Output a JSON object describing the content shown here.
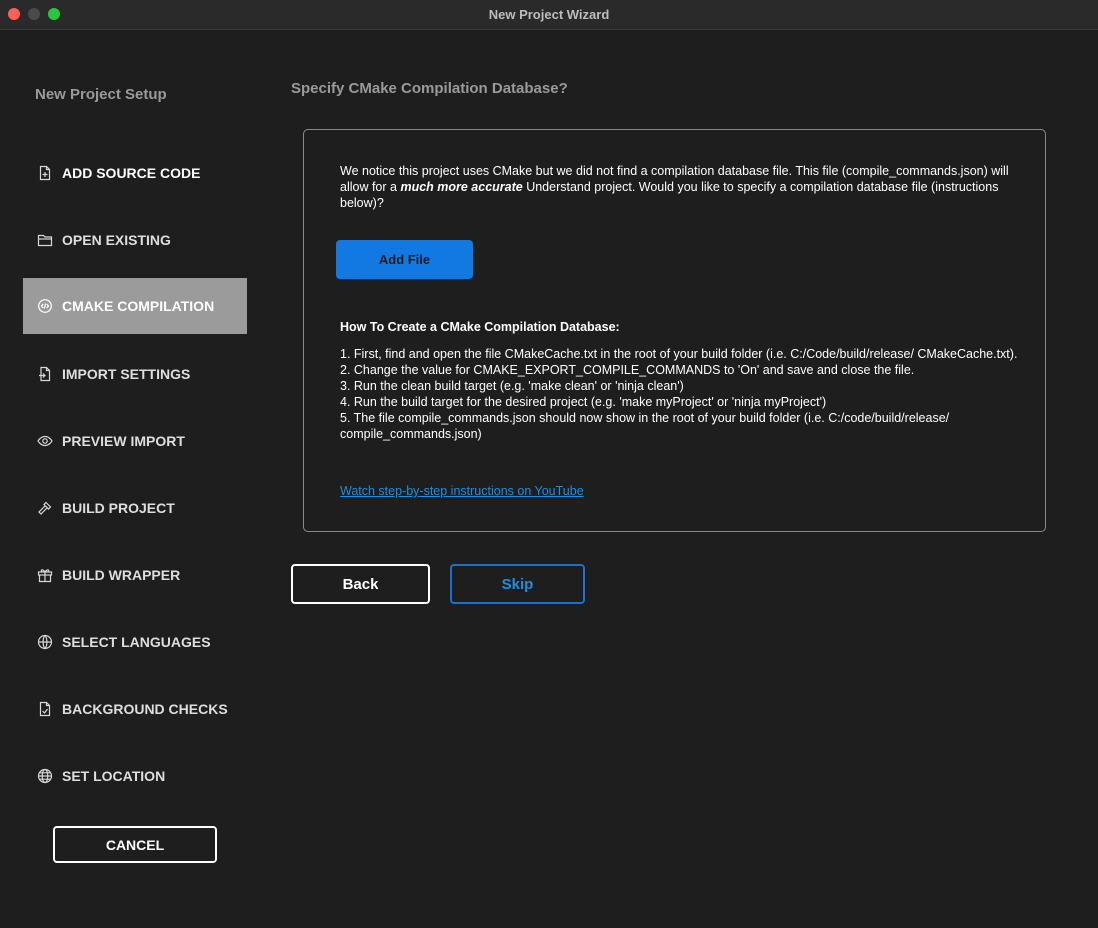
{
  "window": {
    "title": "New Project Wizard"
  },
  "sidebar": {
    "heading": "New Project Setup",
    "items": [
      {
        "label": "ADD SOURCE CODE",
        "icon": "file-add-icon"
      },
      {
        "label": "OPEN EXISTING",
        "icon": "folder-open-icon"
      },
      {
        "label": "CMAKE COMPILATION",
        "icon": "code-gear-icon",
        "active": true
      },
      {
        "label": "IMPORT SETTINGS",
        "icon": "file-import-icon"
      },
      {
        "label": "PREVIEW IMPORT",
        "icon": "eye-icon"
      },
      {
        "label": "BUILD PROJECT",
        "icon": "hammer-icon"
      },
      {
        "label": "BUILD WRAPPER",
        "icon": "gift-icon"
      },
      {
        "label": "SELECT LANGUAGES",
        "icon": "code-circle-icon"
      },
      {
        "label": "BACKGROUND CHECKS",
        "icon": "file-check-icon"
      },
      {
        "label": "SET LOCATION",
        "icon": "globe-icon"
      }
    ],
    "cancel_label": "CANCEL"
  },
  "main": {
    "heading": "Specify CMake Compilation Database?",
    "intro_before": "We notice this project uses CMake but we did not find a compilation database file. This file (compile_commands.json) will allow for a ",
    "intro_emphasis": "much more accurate",
    "intro_after": " Understand project. Would you like to specify a compilation database file (instructions below)?",
    "add_file_label": "Add File",
    "howto_title": "How To Create a CMake Compilation Database:",
    "steps": [
      "1. First, find and open the file CMakeCache.txt in the root of your build folder (i.e. C:/Code/build/release/ CMakeCache.txt).",
      "2. Change the value for CMAKE_EXPORT_COMPILE_COMMANDS to 'On' and save and close the file.",
      "3. Run the clean build target (e.g. 'make clean' or 'ninja clean')",
      "4. Run the build target for the desired project (e.g. 'make myProject' or 'ninja myProject')",
      "5. The file compile_commands.json should now show in the root of your build folder (i.e. C:/code/build/release/ compile_commands.json)"
    ],
    "youtube_link": "Watch step-by-step instructions on YouTube",
    "back_label": "Back",
    "skip_label": "Skip"
  },
  "colors": {
    "background": "#1e1e1e",
    "active_nav": "#9b9b9b",
    "accent": "#1279e3",
    "link": "#1e8ee0"
  }
}
